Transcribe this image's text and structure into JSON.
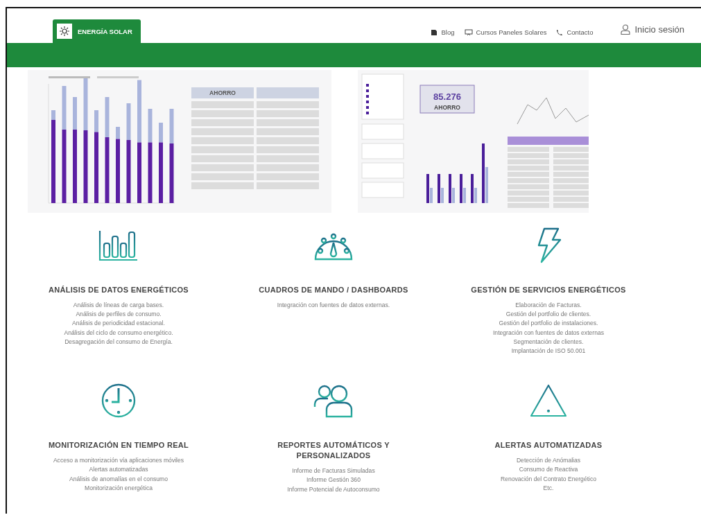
{
  "header": {
    "logo": "ENERGÍA SOLAR",
    "nav": [
      {
        "kind": "blog",
        "label": "Blog"
      },
      {
        "kind": "course",
        "label": "Cursos Paneles Solares"
      },
      {
        "kind": "phone",
        "label": "Contacto"
      }
    ],
    "login": "Inicio sesión"
  },
  "dashboards": {
    "left_table_header": "AHORRO",
    "kpi_value": "85.276",
    "kpi_label": "AHORRO"
  },
  "features": [
    {
      "kind": "bars",
      "title": "ANÁLISIS DE DATOS ENERGÉTICOS",
      "lines": [
        "Análisis de líneas de carga bases.",
        "Análisis de perfiles de consumo.",
        "Análisis de periodicidad estacional.",
        "Análisis del ciclo de consumo energético.",
        "Desagregación del consumo de Energía."
      ]
    },
    {
      "kind": "gauge",
      "title": "CUADROS DE MANDO / DASHBOARDS",
      "lines": [
        "Integración con fuentes de datos externas."
      ]
    },
    {
      "kind": "bolt",
      "title": "GESTIÓN DE SERVICIOS ENERGÉTICOS",
      "lines": [
        "Elaboración de Facturas.",
        "Gestión del portfolio de clientes.",
        "Gestión del portfolio de instalaciones.",
        "Integración con fuentes de datos externas",
        "Segmentación de clientes.",
        "Implantación de ISO 50.001"
      ]
    },
    {
      "kind": "clock",
      "title": "MONITORIZACIÓN EN TIEMPO REAL",
      "lines": [
        "Acceso a monitorización vía aplicaciones móviles",
        "Alertas automatizadas",
        "Análisis de anomalías en el consumo",
        "Monitorización energética"
      ]
    },
    {
      "kind": "users",
      "title": "REPORTES AUTOMÁTICOS Y PERSONALIZADOS",
      "lines": [
        "Informe de Facturas Simuladas",
        "Informe Gestión 360",
        "Informe Potencial de Autoconsumo"
      ]
    },
    {
      "kind": "warning",
      "title": "ALERTAS AUTOMATIZADAS",
      "lines": [
        "Detección de Anómalias",
        "Consumo de Reactiva",
        "Renovación del Contrato Energético",
        "Etc."
      ]
    }
  ]
}
